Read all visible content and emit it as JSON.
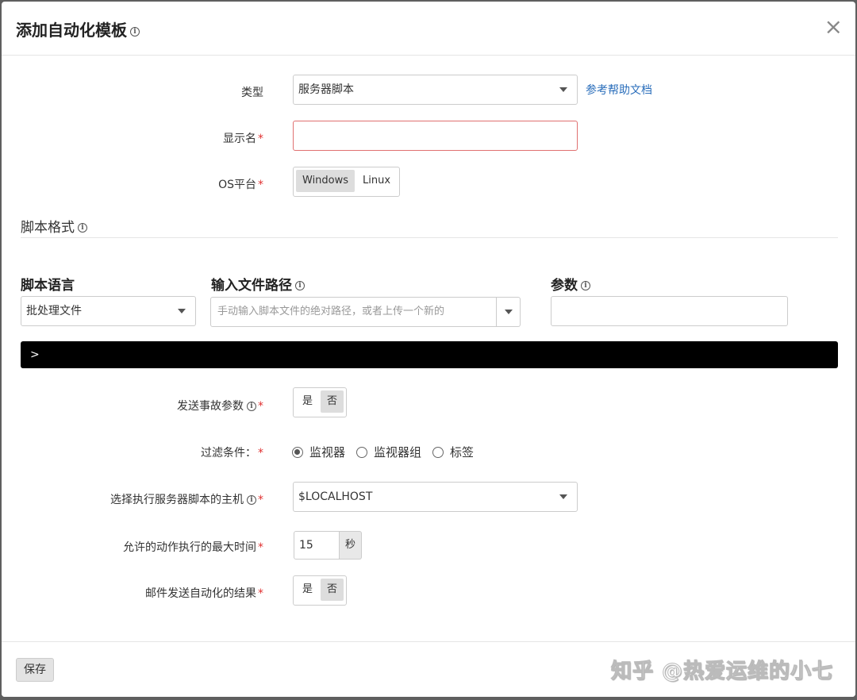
{
  "dialog": {
    "title": "添加自动化模板",
    "close": "×"
  },
  "form": {
    "type_label": "类型",
    "type_value": "服务器脚本",
    "help_link": "参考帮助文档",
    "display_name_label": "显示名",
    "display_name_value": "",
    "os_label": "OS平台",
    "os_options": [
      "Windows",
      "Linux"
    ],
    "os_selected": "Windows",
    "required_mark": "*"
  },
  "script_format": {
    "section_title": "脚本格式",
    "language_header": "脚本语言",
    "language_value": "批处理文件",
    "path_header": "输入文件路径",
    "path_placeholder": "手动输入脚本文件的绝对路径，或者上传一个新的",
    "params_header": "参数",
    "params_value": "",
    "console_prompt": ">"
  },
  "options": {
    "send_incident_label": "发送事故参数",
    "send_incident_yes": "是",
    "send_incident_no": "否",
    "send_incident_selected": "否",
    "filter_label": "过滤条件：",
    "filter_options": [
      "监视器",
      "监视器组",
      "标签"
    ],
    "filter_selected": "监视器",
    "host_label": "选择执行服务器脚本的主机",
    "host_value": "$LOCALHOST",
    "max_time_label": "允许的动作执行的最大时间",
    "max_time_value": "15",
    "max_time_unit": "秒",
    "email_label": "邮件发送自动化的结果",
    "email_yes": "是",
    "email_no": "否",
    "email_selected": "否"
  },
  "footer": {
    "save_label": "保存",
    "watermark": "知乎 @热爱运维的小七"
  }
}
